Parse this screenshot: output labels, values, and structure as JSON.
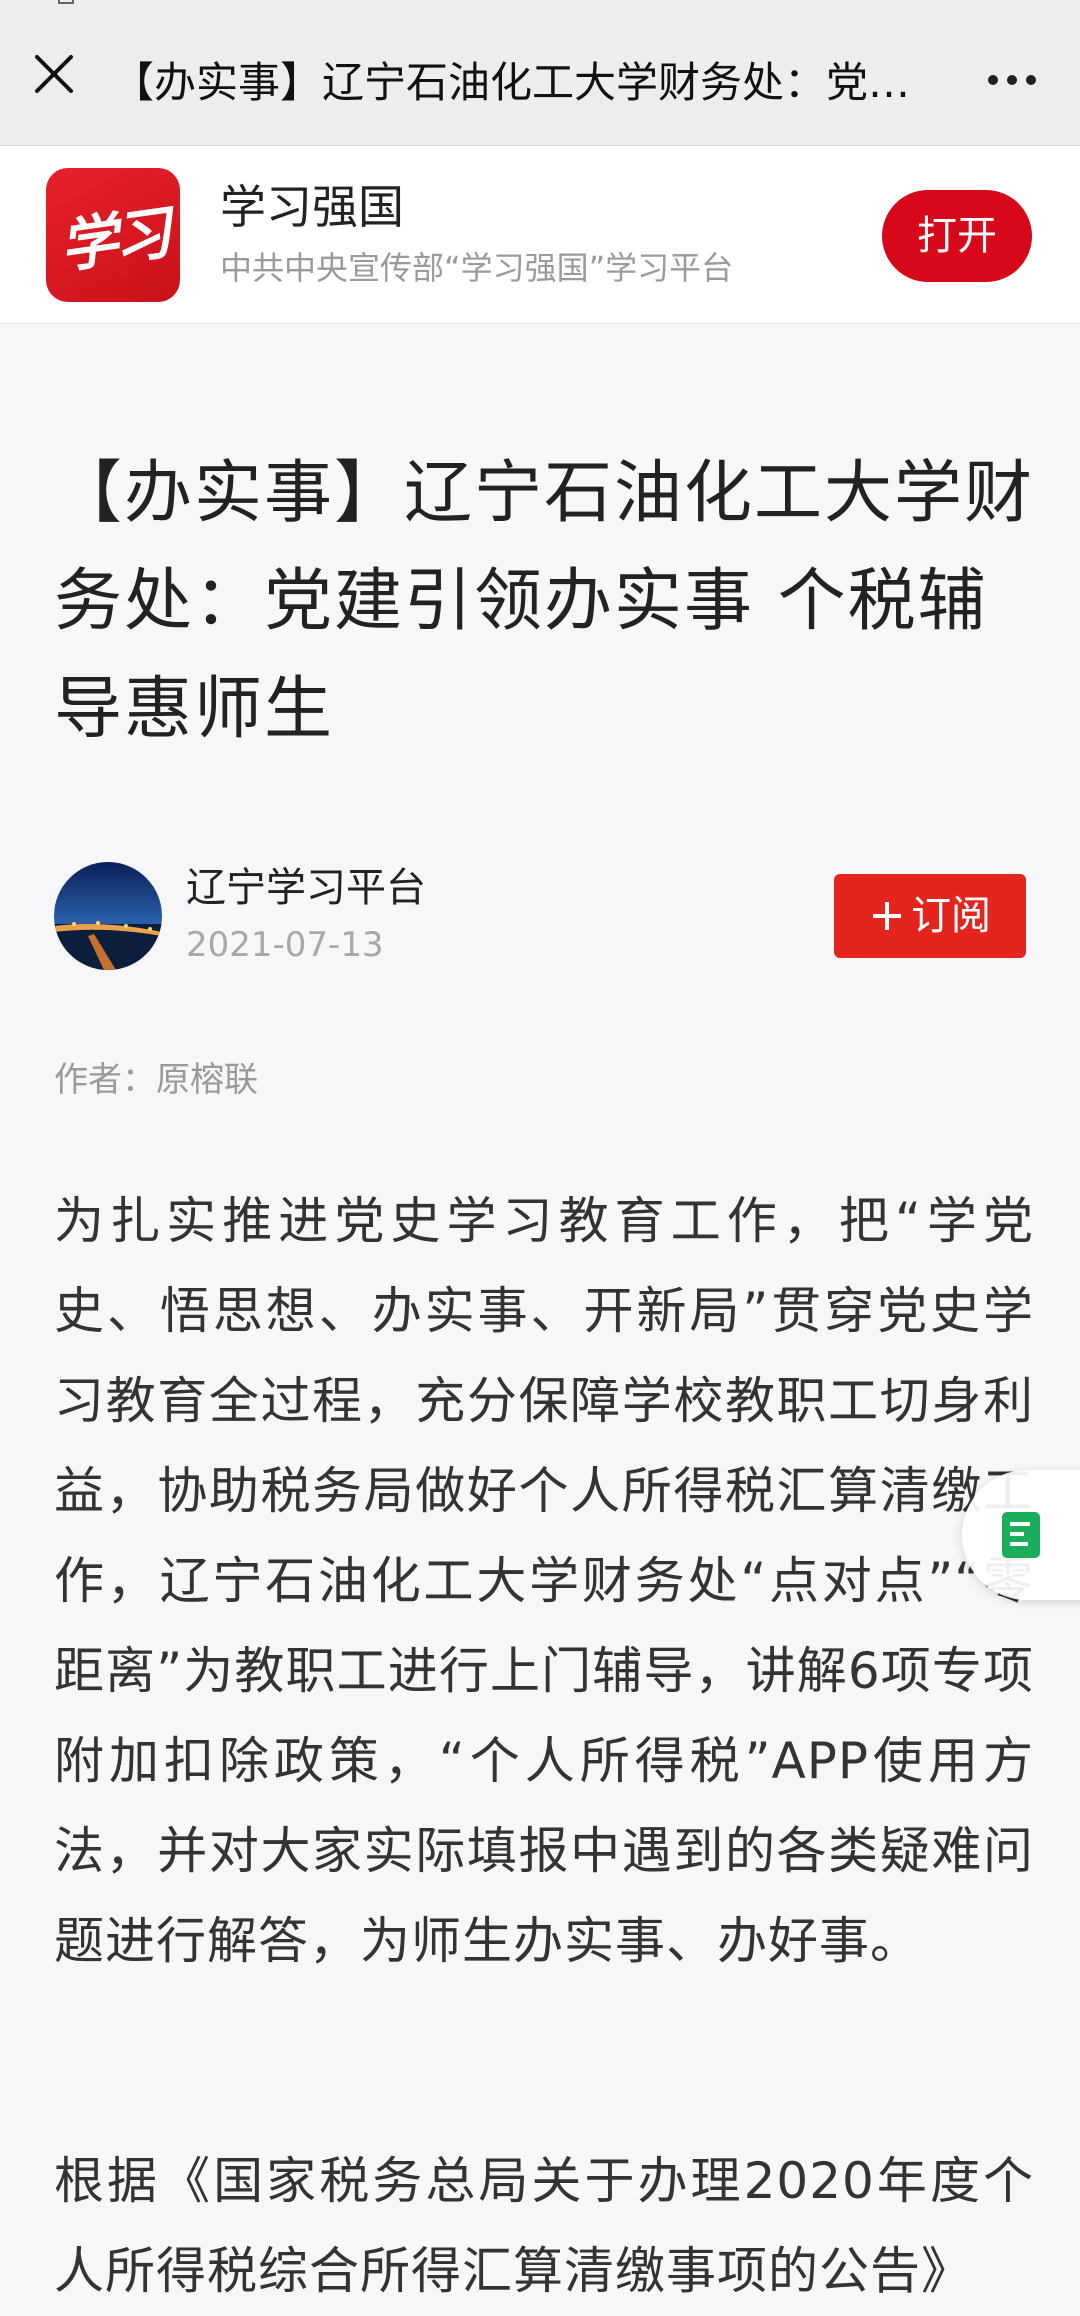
{
  "topbar": {
    "title": "【办实事】辽宁石油化工大学财务处：党建引领办实事 个税辅导惠师生"
  },
  "banner": {
    "app_name": "学习强国",
    "app_desc": "中共中央宣传部“学习强国”学习平台",
    "logo_text": "学习",
    "open_label": "打开"
  },
  "article": {
    "headline": "【办实事】辽宁石油化工大学财务处：党建引领办实事 个税辅导惠师生",
    "source_name": "辽宁学习平台",
    "date": "2021-07-13",
    "subscribe_label": "订阅",
    "byline": "作者：原榕联",
    "paragraphs": [
      "为扎实推进党史学习教育工作，把“学党史、悟思想、办实事、开新局”贯穿党史学习教育全过程，充分保障学校教职工切身利益，协助税务局做好个人所得税汇算清缴工作，辽宁石油化工大学财务处“点对点”“零距离”为教职工进行上门辅导，讲解6项专项附加扣除政策，“个人所得税”APP使用方法，并对大家实际填报中遇到的各类疑难问题进行解答，为师生办实事、办好事。",
      "根据《国家税务总局关于办理2020年度个人所得税综合所得汇算清缴事项的公告》"
    ]
  },
  "icons": {
    "close": "close-icon",
    "more": "more-icon",
    "plus": "plus-icon",
    "float": "document-icon"
  },
  "colors": {
    "brand_red": "#d8081b",
    "subscribe_red": "#e3251d",
    "widget_green": "#1aad5c"
  }
}
